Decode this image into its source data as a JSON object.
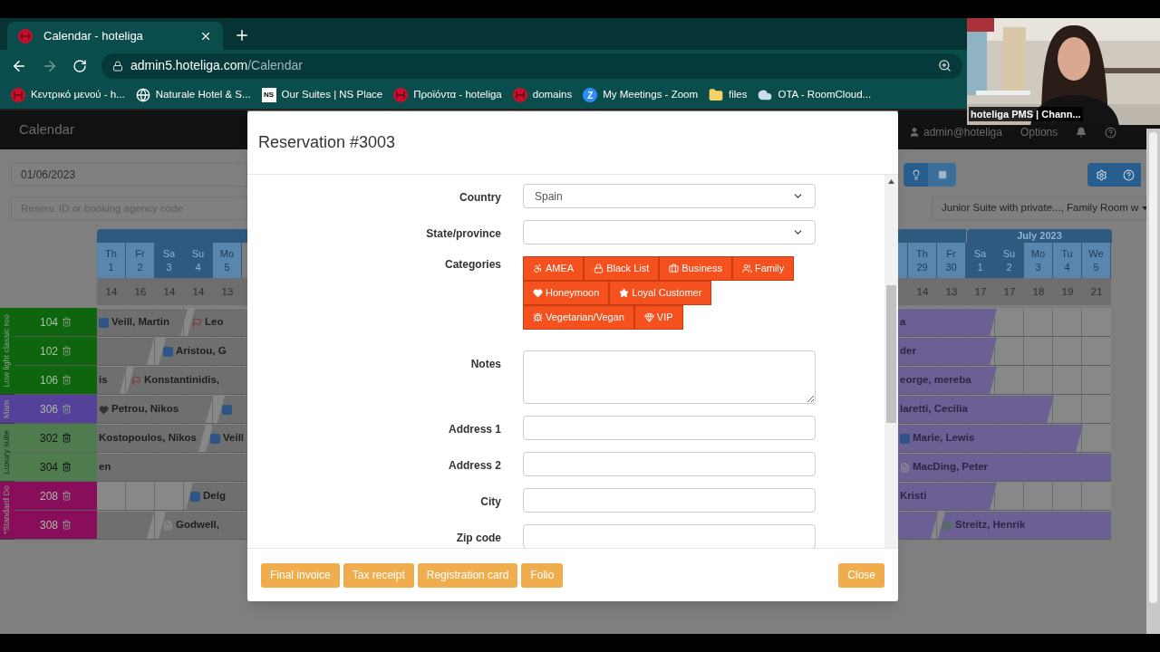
{
  "browser": {
    "tab": {
      "title": "Calendar - hoteliga"
    },
    "address": {
      "host": "admin5.hoteliga.com",
      "path": "/Calendar"
    },
    "bookmarks": [
      {
        "label": "Κεντρικό μενού - h..."
      },
      {
        "label": "Naturale Hotel & S..."
      },
      {
        "badge": "NS",
        "label": "Our Suites | NS Place"
      },
      {
        "label": "Προϊόντα - hoteliga"
      },
      {
        "label": "domains"
      },
      {
        "badge": "Z",
        "label": "My Meetings - Zoom"
      },
      {
        "label": "files"
      },
      {
        "label": "OTA - RoomCloud..."
      }
    ]
  },
  "video_call": {
    "caption": "hoteliga PMS | Chann..."
  },
  "navbar": {
    "title": "Calendar",
    "user": "admin@hoteliga",
    "menu": "Options"
  },
  "toolbar": {
    "date": "01/06/2023",
    "search": {
      "placeholder": "Reserv. ID or booking agency code"
    },
    "room_filter": "Junior Suite with private..., Family Room w"
  },
  "calendar": {
    "start_days": [
      {
        "name": "Th",
        "date": "1",
        "weekend": false,
        "count": "14"
      },
      {
        "name": "Fr",
        "date": "2",
        "weekend": false,
        "count": "16"
      },
      {
        "name": "Sa",
        "date": "3",
        "weekend": true,
        "count": "14"
      },
      {
        "name": "Su",
        "date": "4",
        "weekend": true,
        "count": "14"
      },
      {
        "name": "Mo",
        "date": "5",
        "weekend": false,
        "count": "13"
      }
    ],
    "end_month": "July 2023",
    "end_days": [
      {
        "name": "Th",
        "date": "29",
        "weekend": false,
        "count": "14"
      },
      {
        "name": "Fr",
        "date": "30",
        "weekend": false,
        "count": "13"
      },
      {
        "name": "Sa",
        "date": "1",
        "weekend": true,
        "count": "17"
      },
      {
        "name": "Su",
        "date": "2",
        "weekend": true,
        "count": "17"
      },
      {
        "name": "Mo",
        "date": "3",
        "weekend": false,
        "count": "18"
      },
      {
        "name": "Tu",
        "date": "4",
        "weekend": false,
        "count": "19"
      },
      {
        "name": "We",
        "date": "5",
        "weekend": false,
        "count": "21"
      }
    ],
    "groups": [
      {
        "label": "Low light classic roo",
        "color": "#0e650e",
        "rooms": [
          {
            "number": "104",
            "start_bookings": [
              {
                "kind": "named",
                "guest": "Veill, Martin"
              },
              {
                "kind": "named",
                "guest": "Leo"
              }
            ],
            "end_bookings": [
              {
                "kind": "named",
                "guest": "a"
              }
            ]
          },
          {
            "number": "102",
            "start_bookings": [
              {
                "kind": "empty"
              },
              {
                "kind": "named",
                "guest": "Aristou, G"
              }
            ],
            "end_bookings": [
              {
                "kind": "named",
                "guest": "der"
              }
            ]
          },
          {
            "number": "106",
            "start_bookings": [
              {
                "kind": "named",
                "guest": "is"
              },
              {
                "kind": "named",
                "guest": "Konstantinidis,"
              }
            ],
            "end_bookings": [
              {
                "kind": "named",
                "guest": "eorge, mereba"
              }
            ]
          }
        ]
      },
      {
        "label": "Mam",
        "color": "#55409a",
        "rooms": [
          {
            "number": "306",
            "start_bookings": [
              {
                "kind": "named",
                "guest": "Petrou, Nikos"
              },
              {
                "kind": "empty"
              }
            ],
            "end_bookings": [
              {
                "kind": "named",
                "guest": "laretti, Cecilia"
              }
            ]
          }
        ]
      },
      {
        "label": "Luxury suite",
        "color": "#4e7c4e",
        "rooms": [
          {
            "number": "302",
            "start_bookings": [
              {
                "kind": "named",
                "guest": "Kostopoulos, Nikos"
              },
              {
                "kind": "named",
                "guest": "Veill"
              }
            ],
            "end_bookings": [
              {
                "kind": "named",
                "guest": "Marie, Lewis"
              }
            ]
          },
          {
            "number": "304",
            "start_bookings": [
              {
                "kind": "named",
                "guest": "en"
              }
            ],
            "end_bookings": [
              {
                "kind": "named",
                "guest": "MacDing, Peter"
              }
            ]
          }
        ]
      },
      {
        "label": "*Standard Do",
        "color": "#880e5c",
        "rooms": [
          {
            "number": "208",
            "start_bookings": [
              {
                "kind": "named",
                "guest": "Delg"
              }
            ],
            "end_bookings": [
              {
                "kind": "named",
                "guest": "Kristi"
              }
            ]
          },
          {
            "number": "308",
            "start_bookings": [
              {
                "kind": "empty"
              },
              {
                "kind": "named",
                "guest": "Godwell, "
              }
            ],
            "end_bookings": [
              {
                "kind": "empty"
              },
              {
                "kind": "named",
                "guest": "Streitz, Henrik"
              }
            ]
          }
        ]
      }
    ]
  },
  "modal": {
    "title": "Reservation #3003",
    "fields": [
      {
        "kind": "select",
        "label": "Country",
        "value": "Spain"
      },
      {
        "kind": "select",
        "label": "State/province"
      },
      {
        "kind": "tags",
        "label": "Categories",
        "tags": [
          "AMEA",
          "Black List",
          "Business",
          "Family",
          "Honeymoon",
          "Loyal Customer",
          "Vegetarian/Vegan",
          "VIP"
        ]
      },
      {
        "kind": "textarea",
        "label": "Notes"
      },
      {
        "kind": "text",
        "label": "Address 1"
      },
      {
        "kind": "text",
        "label": "Address 2"
      },
      {
        "kind": "text",
        "label": "City"
      },
      {
        "kind": "text",
        "label": "Zip code"
      }
    ],
    "actions": [
      "Final invoice",
      "Tax receipt",
      "Registration card",
      "Folio"
    ],
    "close": "Close"
  }
}
